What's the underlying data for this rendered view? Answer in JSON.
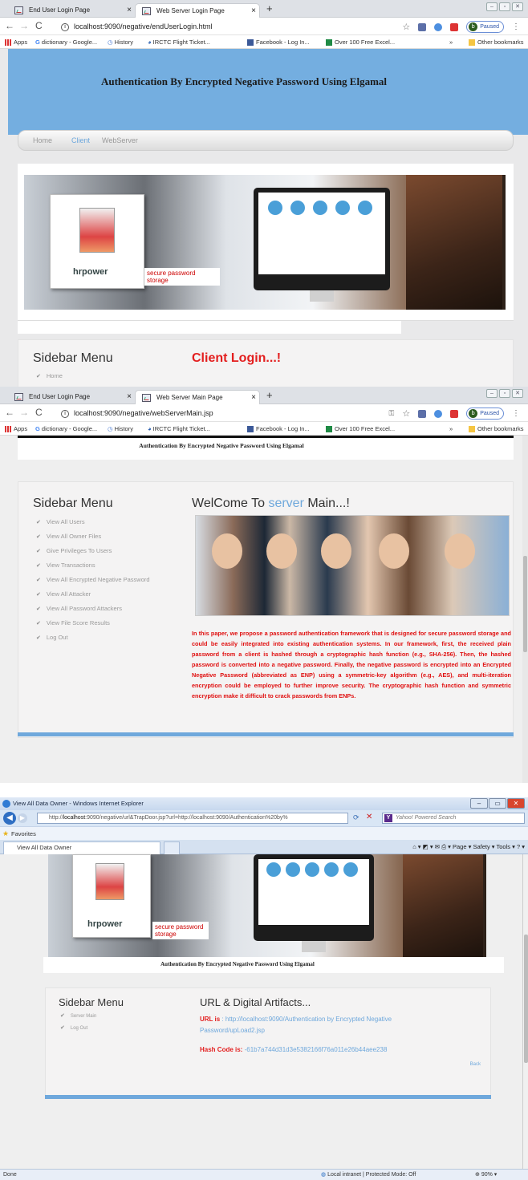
{
  "shot1": {
    "tabs": [
      {
        "label": "End User Login Page",
        "close": "×"
      },
      {
        "label": "Web Server Login Page",
        "close": "×"
      }
    ],
    "new_tab": "+",
    "url": "localhost:9090/negative/endUserLogin.html",
    "paused_label": "Paused",
    "avatar_letter": "b",
    "bookmarks": [
      "Apps",
      "dictionary - Google...",
      "History",
      "IRCTC Flight Ticket...",
      "Facebook - Log In...",
      "Over 100 Free Excel...",
      "»",
      "Other bookmarks"
    ],
    "banner_title": "Authentication By Encrypted Negative Password Using Elgamal",
    "menu": [
      "Home",
      "Client",
      "WebServer"
    ],
    "hero_caption": "secure password storage",
    "hero_logo": "hrpower",
    "sidebar_heading": "Sidebar Menu",
    "sidebar_items": [
      "Home"
    ],
    "main_heading": "Client Login...!"
  },
  "shot2": {
    "tabs": [
      {
        "label": "End User Login Page",
        "close": "×"
      },
      {
        "label": "Web Server Main Page",
        "close": "×"
      }
    ],
    "new_tab": "+",
    "url": "localhost:9090/negative/webServerMain.jsp",
    "paused_label": "Paused",
    "avatar_letter": "b",
    "bookmarks": [
      "Apps",
      "dictionary - Google...",
      "History",
      "IRCTC Flight Ticket...",
      "Facebook - Log In...",
      "Over 100 Free Excel...",
      "»",
      "Other bookmarks"
    ],
    "banner_title": "Authentication By Encrypted Negative Password Using Elgamal",
    "sidebar_heading": "Sidebar Menu",
    "sidebar_items": [
      "View All Users",
      "View All Owner Files",
      "Give Privileges To Users",
      "View Transactions",
      "View All Encrypted Negative Password",
      "View All Attacker",
      "View All Password Attackers",
      "View File Score Results",
      "Log Out"
    ],
    "welcome_prefix": "WelCome To ",
    "welcome_highlight": "server",
    "welcome_suffix": " Main...!",
    "paragraph": "In this paper, we propose a password authentication framework that is designed for secure password storage and could be easily integrated into existing authentication systems. In our framework, first, the received plain password from a client is hashed through a cryptographic hash function (e.g., SHA-256). Then, the hashed password is converted into a negative password. Finally, the negative password is encrypted into an Encrypted Negative Password (abbreviated as ENP) using a symmetric-key algorithm (e.g., AES), and multi-iteration encryption could be employed to further improve security. The cryptographic hash function and symmetric encryption make it difficult to crack passwords from ENPs."
  },
  "shot3": {
    "window_title": "View All Data Owner - Windows Internet Explorer",
    "url_host": "localhost",
    "url_prefix": "http://",
    "url_rest": ":9090/negative/url&TrapDoor.jsp?url=http://localhost:9090/Authentication%20by%",
    "search_placeholder": "Yahoo! Powered Search",
    "favorites": "Favorites",
    "tab_label": "View All Data Owner",
    "tools": "Page ▾  Safety ▾  Tools ▾",
    "hero_caption": "secure password storage",
    "hero_logo": "hrpower",
    "banner_title": "Authentication By Encrypted Negative Password Using Elgamal",
    "sidebar_heading": "Sidebar Menu",
    "sidebar_items": [
      "Server Main",
      "Log Out"
    ],
    "main_heading": "URL & Digital Artifacts...",
    "url_label": "URL is",
    "url_value": ": http://localhost:9090/Authentication by Encrypted Negative Password/upLoad2.jsp",
    "hash_label": "Hash Code is:",
    "hash_value": "-61b7a744d31d3e5382166f76a011e26b44aee238",
    "back_link": "Back",
    "status_done": "Done",
    "status_zone": "Local intranet | Protected Mode: Off",
    "zoom": "90%"
  }
}
